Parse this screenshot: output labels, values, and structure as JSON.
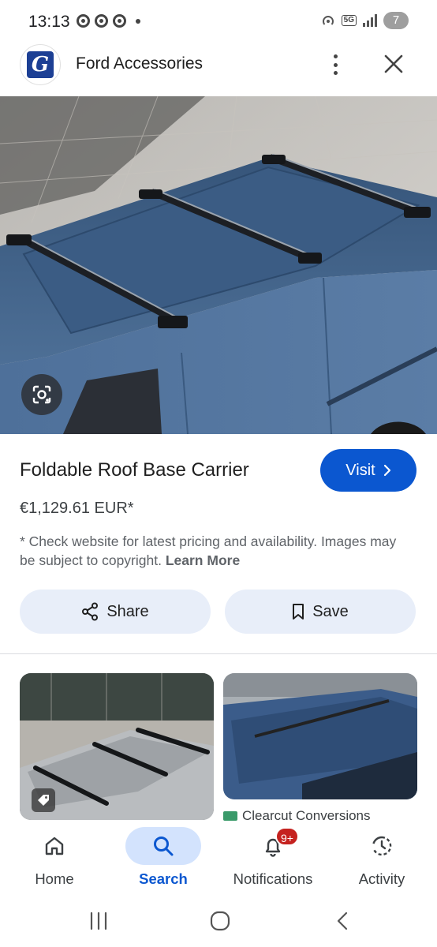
{
  "status_bar": {
    "time": "13:13",
    "network": "5G",
    "battery": "7"
  },
  "header": {
    "site_name": "Ford Accessories",
    "logo_letter": "G"
  },
  "product": {
    "title": "Foldable Roof Base Carrier",
    "price": "€1,129.61 EUR*",
    "disclaimer": "* Check website for latest pricing and availability. Images may be subject to copyright.",
    "learn_more": "Learn More",
    "visit_label": "Visit",
    "share_label": "Share",
    "save_label": "Save"
  },
  "related": {
    "second_source": "Clearcut Conversions"
  },
  "bottom_nav": {
    "items": [
      {
        "label": "Home",
        "icon": "home-icon"
      },
      {
        "label": "Search",
        "icon": "search-icon",
        "active": true
      },
      {
        "label": "Notifications",
        "icon": "bell-icon",
        "badge": "9+"
      },
      {
        "label": "Activity",
        "icon": "activity-icon"
      }
    ]
  },
  "colors": {
    "accent": "#0b57d0",
    "pill_background": "#e8eef9",
    "active_nav": "#d3e3fd",
    "badge": "#c5221f",
    "van_blue": "#3f5e82"
  }
}
